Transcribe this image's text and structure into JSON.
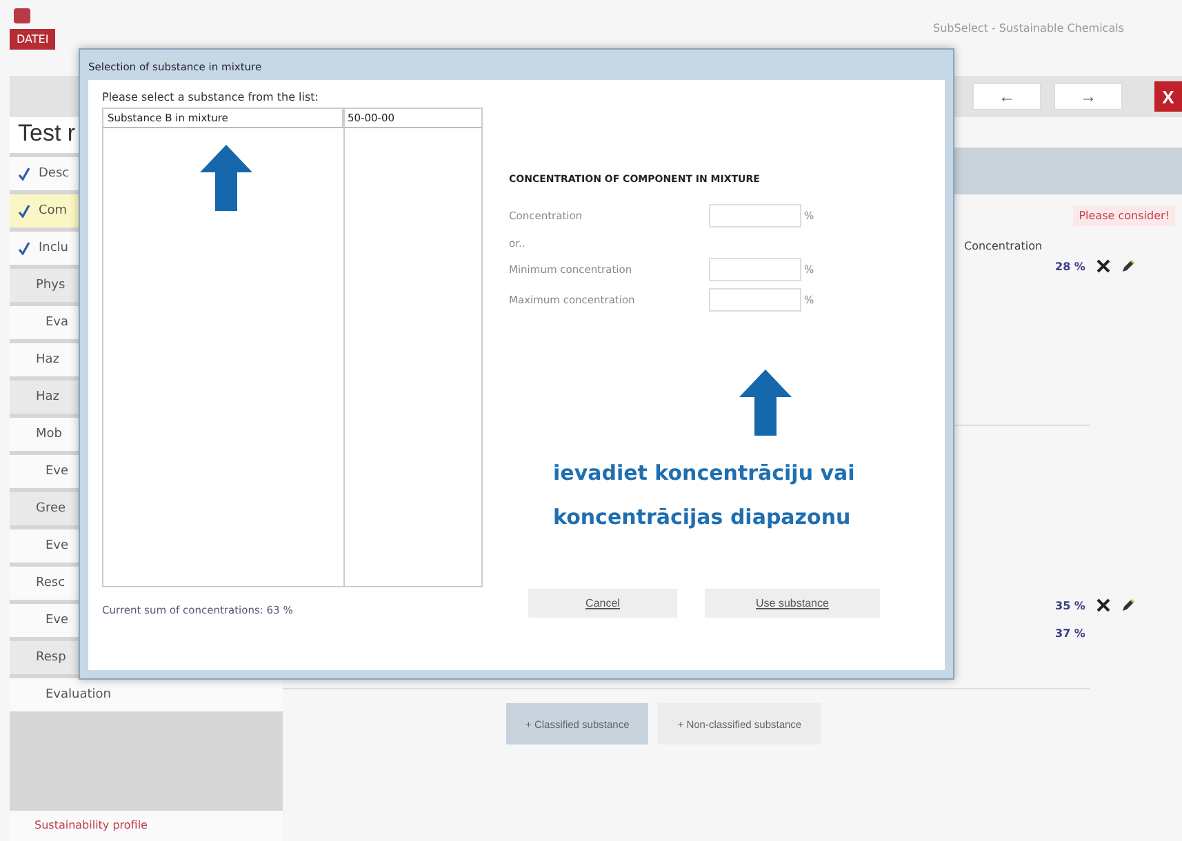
{
  "app": {
    "menu_tab": "DATEI",
    "title": "SubSelect - Sustainable Chemicals",
    "heading": "Test r",
    "close": "X"
  },
  "toolbar": {
    "buttons": [
      "←",
      "→"
    ]
  },
  "sidebar": {
    "items": [
      {
        "label": "Desc",
        "kind": "check",
        "checked": true,
        "selected": false
      },
      {
        "label": "Com",
        "kind": "check",
        "checked": true,
        "selected": true
      },
      {
        "label": "Inclu",
        "kind": "check",
        "checked": true,
        "selected": false
      },
      {
        "label": "Phys",
        "kind": "group",
        "selected": false
      },
      {
        "label": "Eva",
        "kind": "sub",
        "selected": false
      },
      {
        "label": "Haz",
        "kind": "topic",
        "selected": false
      },
      {
        "label": "Haz",
        "kind": "group",
        "selected": false
      },
      {
        "label": "Mob",
        "kind": "topic",
        "selected": false
      },
      {
        "label": "Eve",
        "kind": "sub",
        "selected": false
      },
      {
        "label": "Gree",
        "kind": "group",
        "selected": false
      },
      {
        "label": "Eve",
        "kind": "sub",
        "selected": false
      },
      {
        "label": "Resc",
        "kind": "topic",
        "selected": false
      },
      {
        "label": "Eve",
        "kind": "sub",
        "selected": false
      },
      {
        "label": "Resp",
        "kind": "group",
        "selected": false
      },
      {
        "label": "Evaluation",
        "kind": "sub",
        "selected": false
      }
    ],
    "footer": "Sustainability profile"
  },
  "main": {
    "notice": "Please consider!",
    "column_label": "Concentration",
    "rows": [
      {
        "value": "28 %",
        "actions": true
      },
      {
        "value": "35 %",
        "actions": true
      },
      {
        "value": "37 %",
        "actions": false
      }
    ],
    "buttons": [
      {
        "label": "+ Classified substance",
        "selected": true
      },
      {
        "label": "+ Non-classified substance",
        "selected": false
      }
    ]
  },
  "dialog": {
    "title": "Selection of substance in mixture",
    "prompt": "Please select a substance from the list:",
    "list": {
      "rows": [
        {
          "column_1": "Substance B in mixture",
          "column_2": "50-00-00"
        }
      ]
    },
    "sum": "Current sum of concentrations: 63 %",
    "section_title": "CONCENTRATION OF COMPONENT IN MIXTURE",
    "fields": [
      {
        "label": "Concentration",
        "unit": "%"
      },
      {
        "label": "Minimum concentration",
        "unit": "%"
      },
      {
        "label": "Maximum concentration",
        "unit": "%"
      }
    ],
    "or": "or..",
    "hint": [
      "ievadiet koncentrāciju vai",
      "koncentrācijas diapazonu"
    ],
    "buttons": [
      "Cancel",
      "Use substance"
    ]
  }
}
